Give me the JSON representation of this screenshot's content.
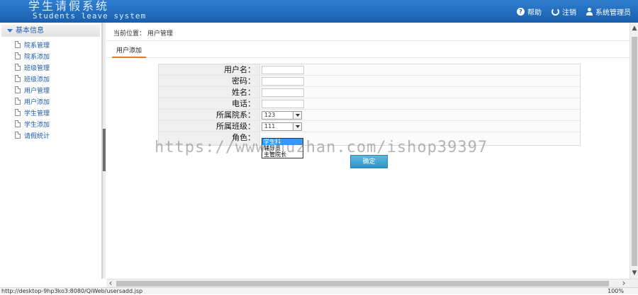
{
  "header": {
    "logo_cn": "学生请假系统",
    "logo_en": "Students leave system",
    "links": [
      {
        "label": "帮助",
        "icon": "help-icon"
      },
      {
        "label": "注销",
        "icon": "logout-icon"
      },
      {
        "label": "系统管理员",
        "icon": "user-icon"
      }
    ]
  },
  "sidebar": {
    "group": "基本信息",
    "items": [
      "院系管理",
      "院系添加",
      "班级管理",
      "班级添加",
      "用户管理",
      "用户添加",
      "学生管理",
      "学生添加",
      "请假统计"
    ]
  },
  "breadcrumb": "当前位置： 用户管理",
  "tab": "用户添加",
  "form": {
    "username_label": "用户名：",
    "password_label": "密码：",
    "name_label": "姓名：",
    "phone_label": "电话：",
    "dept_label": "所属院系：",
    "dept_value": "123",
    "class_label": "所属班级：",
    "class_value": "111",
    "role_label": "角色：",
    "role_options": [
      "学生科",
      "辅导员",
      "主管院长"
    ],
    "submit_label": "确定"
  },
  "watermark": "https://www.huzhan.com/ishop39397",
  "statusbar": {
    "url": "http://desktop-9hp3ko3:8080/QiWeb/usersadd.jsp",
    "zoom": "100%"
  },
  "colors": {
    "header": "#1a5fae",
    "accent_tab": "#e07a34",
    "button": "#2f92c6"
  }
}
